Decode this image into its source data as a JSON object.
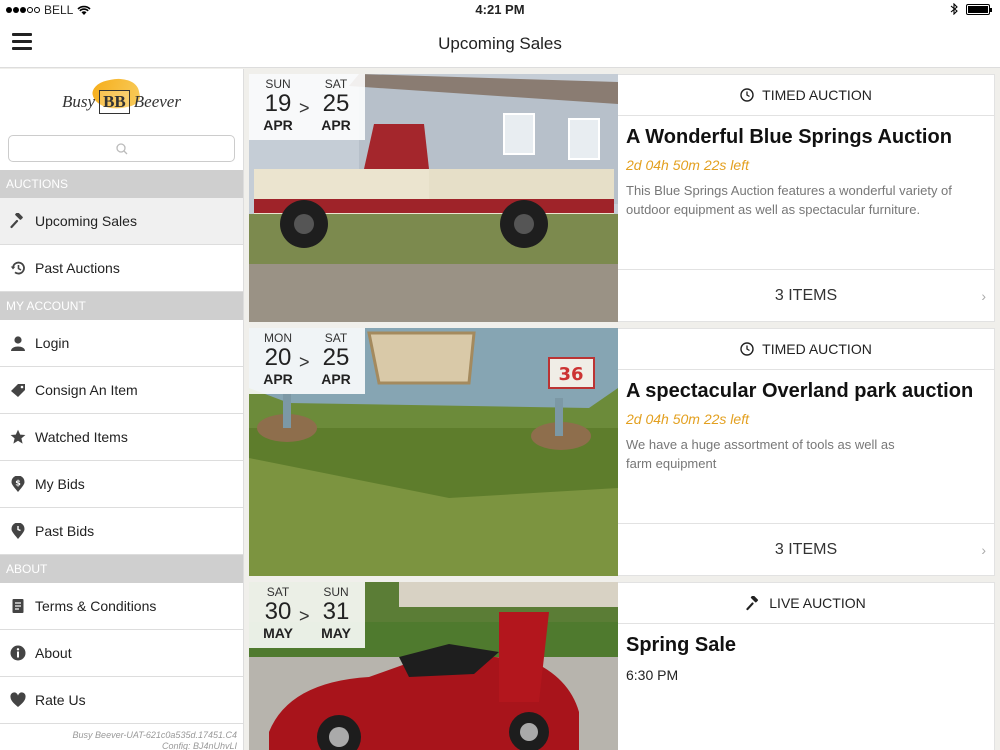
{
  "status_bar": {
    "carrier": "BELL",
    "time": "4:21 PM",
    "battery": 1.0
  },
  "navbar": {
    "title": "Upcoming Sales"
  },
  "sidebar": {
    "logo": {
      "left": "Busy",
      "mark": "BB",
      "right": "Beever"
    },
    "search": {
      "placeholder": ""
    },
    "sections": {
      "auctions": "AUCTIONS",
      "account": "MY ACCOUNT",
      "about": "ABOUT"
    },
    "auctions_items": [
      {
        "label": "Upcoming Sales",
        "icon": "gavel-icon"
      },
      {
        "label": "Past Auctions",
        "icon": "history-icon"
      }
    ],
    "account_items": [
      {
        "label": "Login",
        "icon": "user-icon"
      },
      {
        "label": "Consign An Item",
        "icon": "tag-icon"
      },
      {
        "label": "Watched Items",
        "icon": "star-icon"
      },
      {
        "label": "My Bids",
        "icon": "dollar-pin-icon"
      },
      {
        "label": "Past Bids",
        "icon": "clock-pin-icon"
      }
    ],
    "about_items": [
      {
        "label": "Terms & Conditions",
        "icon": "document-icon"
      },
      {
        "label": "About",
        "icon": "info-icon"
      },
      {
        "label": "Rate Us",
        "icon": "heart-icon"
      }
    ],
    "footer_line1": "Busy Beever-UAT-621c0a535d.17451.C4",
    "footer_line2": "Config: BJ4nUhvLI"
  },
  "sales": [
    {
      "type_label": "TIMED AUCTION",
      "type_icon": "clock-icon",
      "start": {
        "dow": "SUN",
        "day": "19",
        "month": "APR"
      },
      "end": {
        "dow": "SAT",
        "day": "25",
        "month": "APR"
      },
      "title": "A Wonderful Blue Springs Auction",
      "time_left": "2d 04h 50m 22s left",
      "description": "This Blue Springs Auction features a wonderful variety of outdoor equipment as well as spectacular furniture.",
      "items_label": "3 ITEMS",
      "image": "red-pickup-truck-photo"
    },
    {
      "type_label": "TIMED AUCTION",
      "type_icon": "clock-icon",
      "start": {
        "dow": "MON",
        "day": "20",
        "month": "APR"
      },
      "end": {
        "dow": "SAT",
        "day": "25",
        "month": "APR"
      },
      "title": "A spectacular Overland park auction",
      "time_left": "2d 04h 50m 22s left",
      "description": "We have a huge assortment of tools as well as farm equipment",
      "items_label": "3 ITEMS",
      "image": "soapbox-racer-photo"
    },
    {
      "type_label": "LIVE AUCTION",
      "type_icon": "gavel-icon",
      "start": {
        "dow": "SAT",
        "day": "30",
        "month": "MAY"
      },
      "end": {
        "dow": "SUN",
        "day": "31",
        "month": "MAY"
      },
      "title": "Spring Sale",
      "start_time": "6:30 PM",
      "image": "red-sports-car-photo"
    }
  ],
  "separator": ">"
}
